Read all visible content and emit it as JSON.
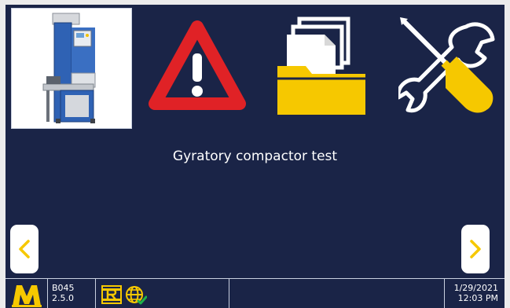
{
  "main": {
    "caption": "Gyratory compactor test",
    "tiles": [
      {
        "id": "machine",
        "icon": "gyratory-compactor-machine-image"
      },
      {
        "id": "warning",
        "icon": "warning-triangle-icon"
      },
      {
        "id": "files",
        "icon": "folder-files-icon"
      },
      {
        "id": "tools",
        "icon": "wrench-screwdriver-icon"
      }
    ]
  },
  "navigation": {
    "prev_icon": "chevron-left-icon",
    "next_icon": "chevron-right-icon"
  },
  "statusbar": {
    "model": "B045",
    "version": "2.5.0",
    "date": "1/29/2021",
    "time": "12:03 PM",
    "icons": [
      "m-logo-icon",
      "r-logo-icon",
      "globe-connected-icon"
    ]
  },
  "colors": {
    "background": "#1a2447",
    "accent_yellow": "#f6c800",
    "warning_red": "#e02226",
    "border": "#c9d0e0"
  }
}
